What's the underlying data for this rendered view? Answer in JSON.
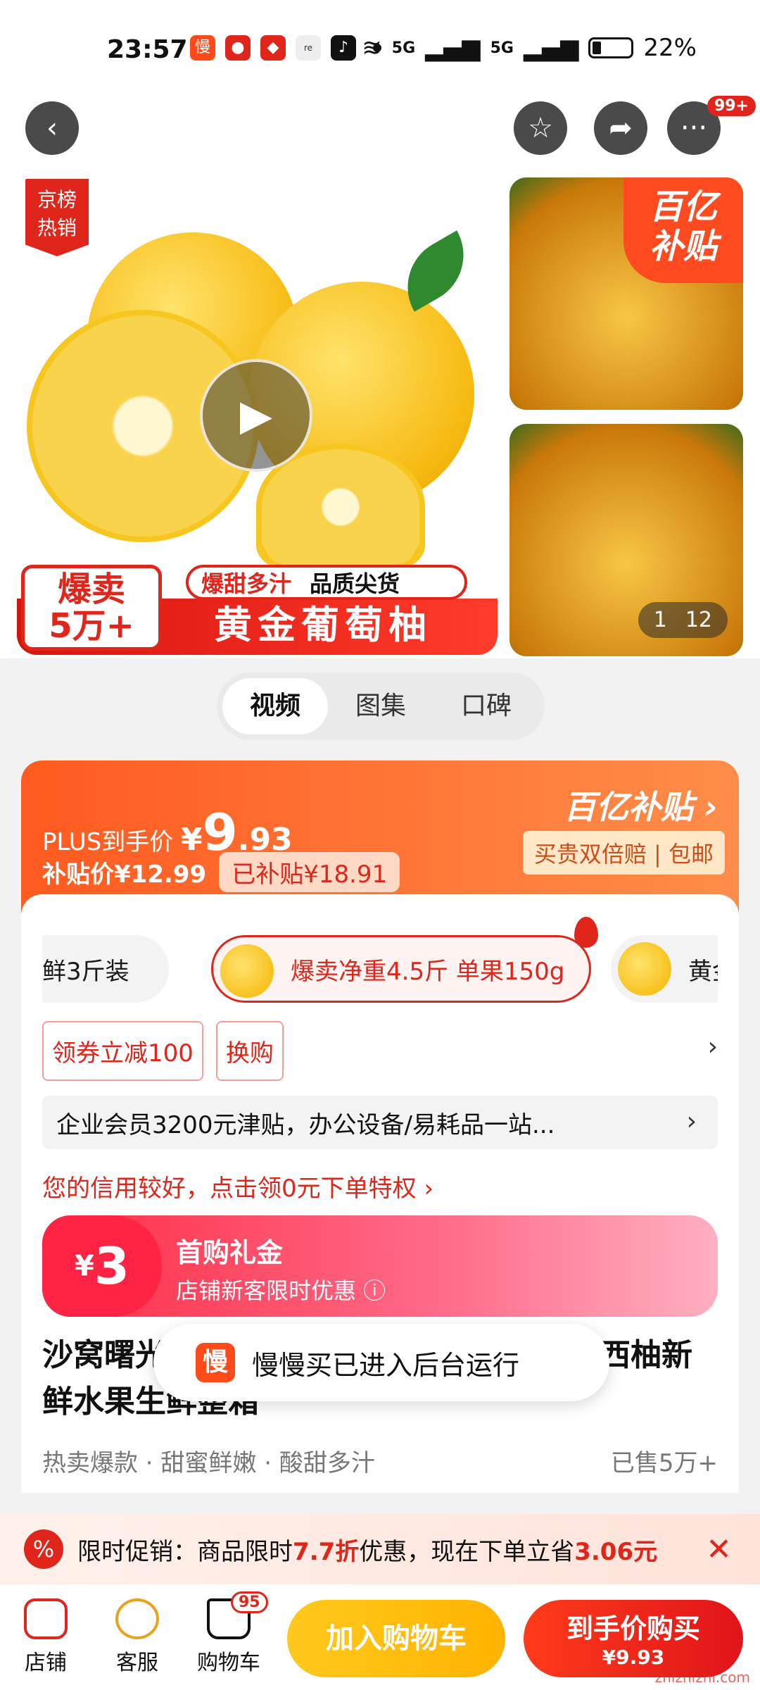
{
  "status_bar": {
    "time": "23:57",
    "battery": "22%",
    "signal1": "5G",
    "signal2": "5G"
  },
  "nav": {
    "more_badge": "99+"
  },
  "gallery": {
    "rank_badge_line1": "京榜",
    "rank_badge_line2": "热销",
    "hot_label_line1": "爆卖",
    "hot_label_line2": "5万+",
    "tag_sweet": "爆甜多汁",
    "tag_quality": "品质尖货",
    "banner_title": "黄金葡萄柚",
    "subsidy_line1": "百亿",
    "subsidy_line2": "补贴",
    "counter_current": "1",
    "counter_total": "12"
  },
  "tabs": [
    {
      "label": "视频",
      "active": true
    },
    {
      "label": "图集",
      "active": false
    },
    {
      "label": "口碑",
      "active": false
    }
  ],
  "price": {
    "plus_label": "PLUS到手价",
    "currency": "¥",
    "plus_int": "9",
    "plus_dec": ".93",
    "subsidy_price": "补贴价¥12.99",
    "subsidized_pill": "已补贴¥18.91",
    "subsidy_logo": "百亿补贴",
    "guarantee": "买贵双倍赔 | 包邮"
  },
  "specs": [
    {
      "label": "鲜3斤装"
    },
    {
      "label": "爆卖净重4.5斤 单果150g"
    },
    {
      "label": "黄金"
    }
  ],
  "coupons": [
    "领券立减100",
    "换购"
  ],
  "corp_notice": "企业会员3200元津贴，办公设备/易耗品一站...",
  "credit_notice": "您的信用较好，点击领0元下单特权 ›",
  "gift": {
    "amount_symbol": "¥",
    "amount": "3",
    "title": "首购礼金",
    "subtitle": "店铺新客限时优惠 ⓘ"
  },
  "product": {
    "title": "沙窝曙光福建黄金葡萄柚子爆汁纯甜黄心西柚新鲜水果生鲜整箱",
    "tags": "热卖爆款 · 甜蜜鲜嫩 · 酸甜多汁",
    "sold": "已售5万+"
  },
  "toast": {
    "icon_text": "慢",
    "message": "慢慢买已进入后台运行"
  },
  "promo": {
    "icon": "%",
    "prefix": "限时促销：商品限时",
    "discount": "7.7折",
    "middle": "优惠，现在下单立省",
    "saving": "3.06元"
  },
  "bottom_bar": {
    "store": "店铺",
    "service": "客服",
    "cart": "购物车",
    "cart_count": "95",
    "add_to_cart": "加入购物车",
    "buy_line1": "到手价购买",
    "buy_line2": "¥9.93"
  },
  "watermark": "zhizhizhi.com"
}
